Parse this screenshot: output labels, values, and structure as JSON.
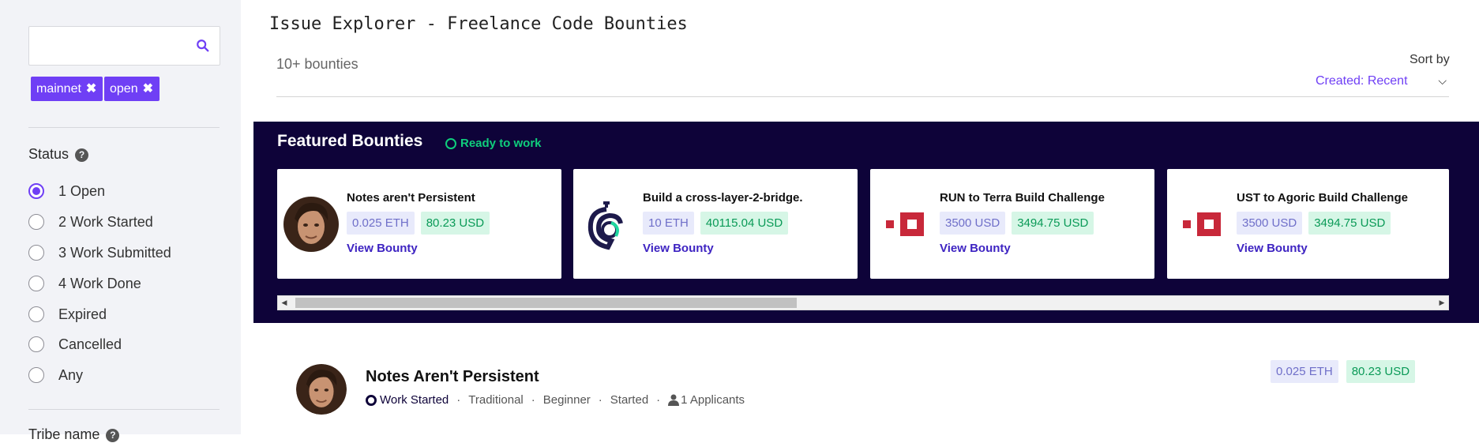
{
  "sidebar": {
    "search": {
      "placeholder": ""
    },
    "chips": [
      {
        "label": "mainnet"
      },
      {
        "label": "open"
      }
    ],
    "status_title": "Status",
    "status_help": "?",
    "status_options": [
      {
        "label": "1 Open",
        "selected": true
      },
      {
        "label": "2 Work Started",
        "selected": false
      },
      {
        "label": "3 Work Submitted",
        "selected": false
      },
      {
        "label": "4 Work Done",
        "selected": false
      },
      {
        "label": "Expired",
        "selected": false
      },
      {
        "label": "Cancelled",
        "selected": false
      },
      {
        "label": "Any",
        "selected": false
      }
    ],
    "tribe_title": "Tribe name"
  },
  "header": {
    "title": "Issue Explorer - Freelance Code Bounties",
    "count": "10+ bounties",
    "sort_label": "Sort by",
    "sort_value": "Created: Recent"
  },
  "featured": {
    "title": "Featured Bounties",
    "ready_label": "Ready to work",
    "cards": [
      {
        "title": "Notes aren't Persistent",
        "amount": "0.025 ETH",
        "usd": "80.23 USD",
        "link": "View Bounty",
        "logo": "avatar"
      },
      {
        "title": "Build a cross-layer-2-bridge.",
        "amount": "10 ETH",
        "usd": "40115.04 USD",
        "link": "View Bounty",
        "logo": "helmet-logo-icon"
      },
      {
        "title": "RUN to Terra Build Challenge",
        "amount": "3500 USD",
        "usd": "3494.75 USD",
        "link": "View Bounty",
        "logo": "red-squares-logo-icon"
      },
      {
        "title": "UST to Agoric Build Challenge",
        "amount": "3500 USD",
        "usd": "3494.75 USD",
        "link": "View Bounty",
        "logo": "red-squares-logo-icon"
      }
    ]
  },
  "bounty_row": {
    "title": "Notes Aren't Persistent",
    "status": "Work Started",
    "type": "Traditional",
    "level": "Beginner",
    "state": "Started",
    "applicants": "1 Applicants",
    "amount": "0.025 ETH",
    "usd": "80.23 USD"
  },
  "colors": {
    "accent": "#6f3ff5",
    "featured_bg": "#0e0339",
    "ready": "#0fce7c",
    "logo_red": "#c8283a"
  }
}
